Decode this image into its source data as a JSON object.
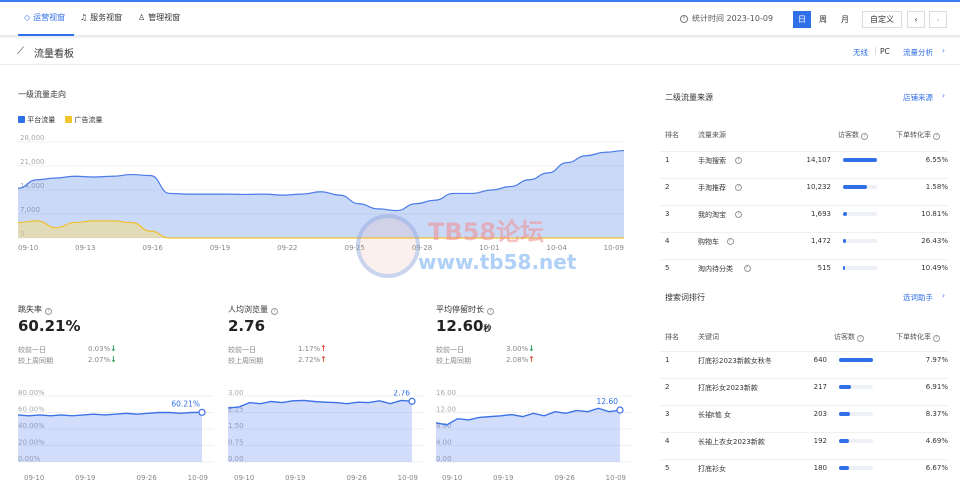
{
  "tabs": [
    {
      "label": "运营视窗",
      "active": true
    },
    {
      "label": "服务视窗",
      "active": false
    },
    {
      "label": "管理视窗",
      "active": false
    }
  ],
  "toolbar": {
    "stat_time_label": "统计时间 2023-10-09",
    "day": "日",
    "week": "周",
    "month": "月",
    "custom": "自定义"
  },
  "section": {
    "title": "流量看板",
    "device_wireless": "无线",
    "device_pc": "PC",
    "analysis_link": "流量分析",
    "chevron": "›"
  },
  "level1": {
    "title": "一级流量走向",
    "legend": [
      {
        "name": "平台流量",
        "color": "#2f6fe8"
      },
      {
        "name": "广告流量",
        "color": "#f3c52d"
      }
    ]
  },
  "chart_data": [
    {
      "type": "area",
      "title": "一级流量走向",
      "ylim": [
        0,
        28000
      ],
      "yticks": [
        "28,000",
        "21,000",
        "14,000",
        "7,000",
        "0"
      ],
      "xticks": [
        "09-10",
        "09-13",
        "09-16",
        "09-19",
        "09-22",
        "09-25",
        "09-28",
        "10-01",
        "10-04",
        "10-09"
      ],
      "series": [
        {
          "name": "平台流量",
          "color": "#2f6fe8",
          "values": [
            14500,
            17000,
            17500,
            18000,
            17800,
            18000,
            18500,
            18200,
            13000,
            12800,
            12800,
            12800,
            12700,
            12800,
            12500,
            12800,
            13500,
            12500,
            10000,
            8500,
            8000,
            10000,
            11000,
            13000,
            13000,
            14000,
            15000,
            17000,
            19000,
            22000,
            24000,
            25000,
            25500
          ]
        },
        {
          "name": "广告流量",
          "color": "#f3c52d",
          "values": [
            4500,
            5000,
            3000,
            4500,
            5000,
            5000,
            4500,
            2000,
            0,
            0,
            0,
            0,
            0,
            0,
            0,
            0,
            0,
            0,
            0,
            0,
            0,
            0,
            0,
            0,
            0,
            0,
            0,
            0,
            0,
            0,
            0,
            0,
            0
          ]
        }
      ]
    },
    {
      "type": "line",
      "title": "跳失率",
      "ylim": [
        0,
        80
      ],
      "yticks": [
        "80.00%",
        "60.00%",
        "40.00%",
        "20.00%",
        "0.00%"
      ],
      "xticks": [
        "09-10",
        "09-19",
        "09-26",
        "10-09"
      ],
      "end_label": "60.21%",
      "series": [
        {
          "name": "跳失率",
          "values": [
            57,
            56,
            57,
            56,
            57,
            56,
            57,
            58,
            57,
            58,
            59,
            58,
            59,
            60,
            60,
            59,
            60,
            60.21
          ]
        }
      ]
    },
    {
      "type": "line",
      "title": "人均浏览量",
      "ylim": [
        0,
        3
      ],
      "yticks": [
        "3.00",
        "2.25",
        "1.50",
        "0.75",
        "0.00"
      ],
      "xticks": [
        "09-10",
        "09-19",
        "09-26",
        "10-09"
      ],
      "end_label": "2.76",
      "series": [
        {
          "name": "人均浏览量",
          "values": [
            2.45,
            2.5,
            2.7,
            2.65,
            2.75,
            2.7,
            2.78,
            2.8,
            2.75,
            2.72,
            2.7,
            2.65,
            2.72,
            2.7,
            2.78,
            2.65,
            2.8,
            2.76
          ]
        }
      ]
    },
    {
      "type": "line",
      "title": "平均停留时长",
      "ylim": [
        0,
        16
      ],
      "yticks": [
        "16.00",
        "12.00",
        "8.00",
        "4.00",
        "0.00"
      ],
      "xticks": [
        "09-10",
        "09-19",
        "09-26",
        "10-09"
      ],
      "end_label": "12.60",
      "series": [
        {
          "name": "平均停留时长",
          "values": [
            9.5,
            9,
            10.5,
            10.2,
            10.8,
            11,
            11.2,
            11.5,
            11,
            11.8,
            11.2,
            12.2,
            11.8,
            12.5,
            12.2,
            13,
            12.2,
            12.6
          ]
        }
      ]
    }
  ],
  "metrics": [
    {
      "title": "跳失率",
      "value": "60.21%",
      "unit": "",
      "d1_label": "较前一日",
      "d1_value": "0.03%",
      "d1_dir": "down",
      "d2_label": "较上周同期",
      "d2_value": "2.07%",
      "d2_dir": "down"
    },
    {
      "title": "人均浏览量",
      "value": "2.76",
      "unit": "",
      "d1_label": "较前一日",
      "d1_value": "1.17%",
      "d1_dir": "up",
      "d2_label": "较上周同期",
      "d2_value": "2.72%",
      "d2_dir": "up"
    },
    {
      "title": "平均停留时长",
      "value": "12.60",
      "unit": "秒",
      "d1_label": "较前一日",
      "d1_value": "3.00%",
      "d1_dir": "down",
      "d2_label": "较上周同期",
      "d2_value": "2.08%",
      "d2_dir": "up"
    }
  ],
  "level2": {
    "title": "二级流量来源",
    "link": "店铺来源",
    "headers": {
      "rank": "排名",
      "source": "流量来源",
      "visitors": "访客数",
      "conv": "下单转化率"
    },
    "rows": [
      {
        "rank": "1",
        "name": "手淘搜索",
        "visitors": "14,107",
        "share": 1.0,
        "conv": "6.55%"
      },
      {
        "rank": "2",
        "name": "手淘推荐",
        "visitors": "10,232",
        "share": 0.72,
        "conv": "1.58%"
      },
      {
        "rank": "3",
        "name": "我的淘宝",
        "visitors": "1,693",
        "share": 0.12,
        "conv": "10.81%"
      },
      {
        "rank": "4",
        "name": "购物车",
        "visitors": "1,472",
        "share": 0.1,
        "conv": "26.43%"
      },
      {
        "rank": "5",
        "name": "淘内待分类",
        "visitors": "515",
        "share": 0.04,
        "conv": "10.49%"
      }
    ]
  },
  "keywords": {
    "title": "搜索词排行",
    "link": "选词助手",
    "headers": {
      "rank": "排名",
      "keyword": "关键词",
      "visitors": "访客数",
      "conv": "下单转化率"
    },
    "rows": [
      {
        "rank": "1",
        "name": "打底衫2023新款女秋冬",
        "visitors": "640",
        "share": 1.0,
        "conv": "7.97%"
      },
      {
        "rank": "2",
        "name": "打底衫女2023新款",
        "visitors": "217",
        "share": 0.34,
        "conv": "6.91%"
      },
      {
        "rank": "3",
        "name": "长袖t恤 女",
        "visitors": "203",
        "share": 0.32,
        "conv": "8.37%"
      },
      {
        "rank": "4",
        "name": "长袖上衣女2023新款",
        "visitors": "192",
        "share": 0.3,
        "conv": "4.69%"
      },
      {
        "rank": "5",
        "name": "打底衫女",
        "visitors": "180",
        "share": 0.28,
        "conv": "6.67%"
      }
    ]
  },
  "watermark": {
    "line1": "TB58论坛",
    "line2": "www.tb58.net"
  }
}
